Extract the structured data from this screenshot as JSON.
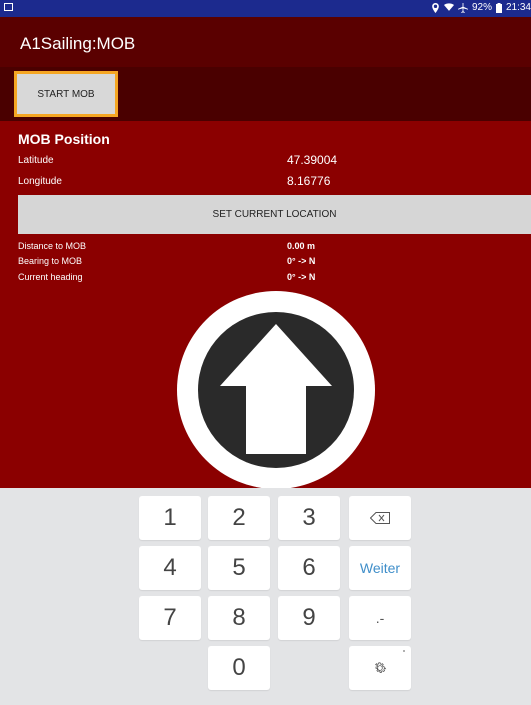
{
  "status_bar": {
    "icons": [
      "location-icon",
      "wifi-icon",
      "airplane-icon"
    ],
    "battery": "92%",
    "time": "21:34"
  },
  "app": {
    "title": "A1Sailing:MOB"
  },
  "actions": {
    "start_mob": "START MOB"
  },
  "mob_position": {
    "title": "MOB Position",
    "latitude_label": "Latitude",
    "latitude_value": "47.39004",
    "longitude_label": "Longitude",
    "longitude_value": "8.16776",
    "set_location_label": "SET CURRENT LOCATION"
  },
  "navigation": {
    "distance_label": "Distance to MOB",
    "distance_value": "0.00 m",
    "bearing_label": "Bearing to MOB",
    "bearing_value": "0° -> N",
    "heading_label": "Current heading",
    "heading_value": "0° -> N"
  },
  "keypad": {
    "keys": [
      "1",
      "2",
      "3",
      "4",
      "5",
      "6",
      "7",
      "8",
      "9",
      "0"
    ],
    "next_label": "Weiter",
    "symbols_label": ".-",
    "backspace_icon": "backspace-icon",
    "settings_icon": "gear-icon"
  },
  "colors": {
    "status_bar": "#1c2a8e",
    "app_bar": "#5a0000",
    "main_bg": "#8b0000",
    "highlight": "#f5a623"
  }
}
